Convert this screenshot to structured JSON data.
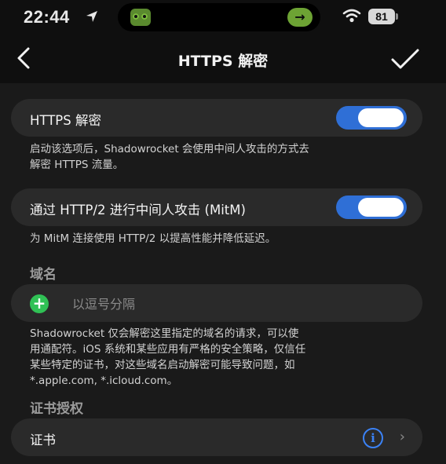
{
  "status_bar": {
    "time": "22:44",
    "battery": "81"
  },
  "nav": {
    "title": "HTTPS 解密"
  },
  "https_decrypt": {
    "label": "HTTPS 解密",
    "enabled": true,
    "footnote_line1": "启动该选项后，Shadowrocket 会使用中间人攻击的方式去",
    "footnote_line2": "解密 HTTPS 流量。"
  },
  "mitm_http2": {
    "label": "通过 HTTP/2 进行中间人攻击 (MitM)",
    "enabled": true,
    "footnote": "为 MitM 连接使用 HTTP/2 以提高性能并降低延迟。"
  },
  "domains": {
    "header": "域名",
    "placeholder": "以逗号分隔",
    "value": "",
    "footnote_line1": "Shadowrocket 仅会解密这里指定的域名的请求，可以使",
    "footnote_line2": "用通配符。iOS 系统和某些应用有严格的安全策略，仅信任",
    "footnote_line3": "某些特定的证书，对这些域名启动解密可能导致问题，如",
    "footnote_line4": "*.apple.com, *.icloud.com。"
  },
  "certificate": {
    "header": "证书授权",
    "label": "证书"
  },
  "colors": {
    "accent_blue": "#2f6fd6",
    "add_green": "#30c155",
    "cell_bg": "#2a2a2a",
    "page_bg": "#1a1a1a"
  }
}
